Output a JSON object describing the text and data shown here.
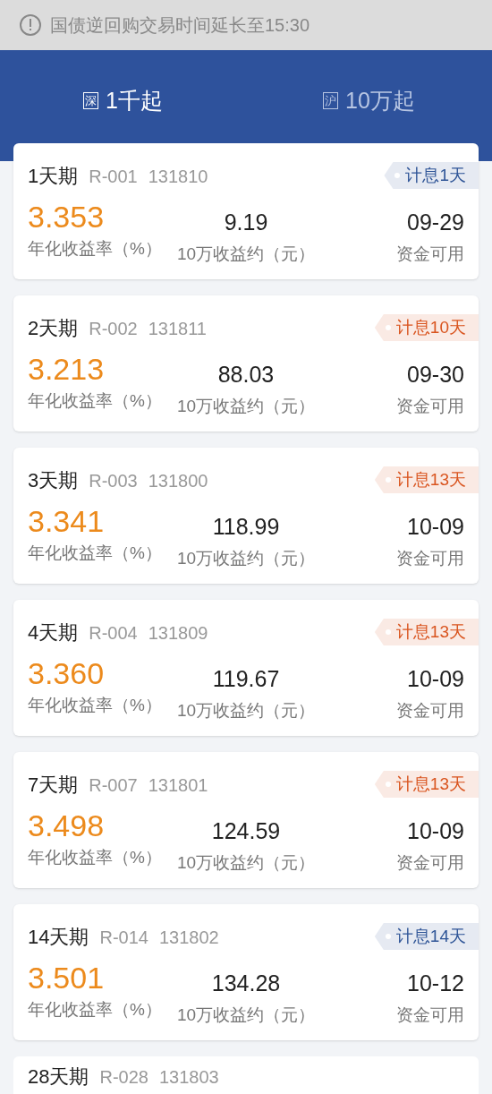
{
  "notice": {
    "text": "国债逆回购交易时间延长至15:30"
  },
  "tabs": [
    {
      "market": "深",
      "label": "1千起",
      "selected": true
    },
    {
      "market": "沪",
      "label": "10万起",
      "selected": false
    }
  ],
  "products": [
    {
      "kind": "full",
      "term": "1天期",
      "code": "R-001",
      "number": "131810",
      "badge": "计息1天",
      "color": "#2f5597",
      "rate": "3.353",
      "rate_label": "年化收益率（%）",
      "income": "9.19",
      "income_label": "10万收益约（元）",
      "date": "09-29",
      "date_label": "资金可用"
    },
    {
      "kind": "full",
      "term": "2天期",
      "code": "R-002",
      "number": "131811",
      "badge": "计息10天",
      "color": "#d9541e",
      "rate": "3.213",
      "rate_label": "年化收益率（%）",
      "income": "88.03",
      "income_label": "10万收益约（元）",
      "date": "09-30",
      "date_label": "资金可用"
    },
    {
      "kind": "full",
      "term": "3天期",
      "code": "R-003",
      "number": "131800",
      "badge": "计息13天",
      "color": "#d9541e",
      "rate": "3.341",
      "rate_label": "年化收益率（%）",
      "income": "118.99",
      "income_label": "10万收益约（元）",
      "date": "10-09",
      "date_label": "资金可用"
    },
    {
      "kind": "full",
      "term": "4天期",
      "code": "R-004",
      "number": "131809",
      "badge": "计息13天",
      "color": "#d9541e",
      "rate": "3.360",
      "rate_label": "年化收益率（%）",
      "income": "119.67",
      "income_label": "10万收益约（元）",
      "date": "10-09",
      "date_label": "资金可用"
    },
    {
      "kind": "full",
      "term": "7天期",
      "code": "R-007",
      "number": "131801",
      "badge": "计息13天",
      "color": "#d9541e",
      "rate": "3.498",
      "rate_label": "年化收益率（%）",
      "income": "124.59",
      "income_label": "10万收益约（元）",
      "date": "10-09",
      "date_label": "资金可用"
    },
    {
      "kind": "full",
      "term": "14天期",
      "code": "R-014",
      "number": "131802",
      "badge": "计息14天",
      "color": "#2f5597",
      "rate": "3.501",
      "rate_label": "年化收益率（%）",
      "income": "134.28",
      "income_label": "10万收益约（元）",
      "date": "10-12",
      "date_label": "资金可用"
    },
    {
      "kind": "header_only",
      "term": "28天期",
      "code": "R-028",
      "number": "131803"
    }
  ]
}
